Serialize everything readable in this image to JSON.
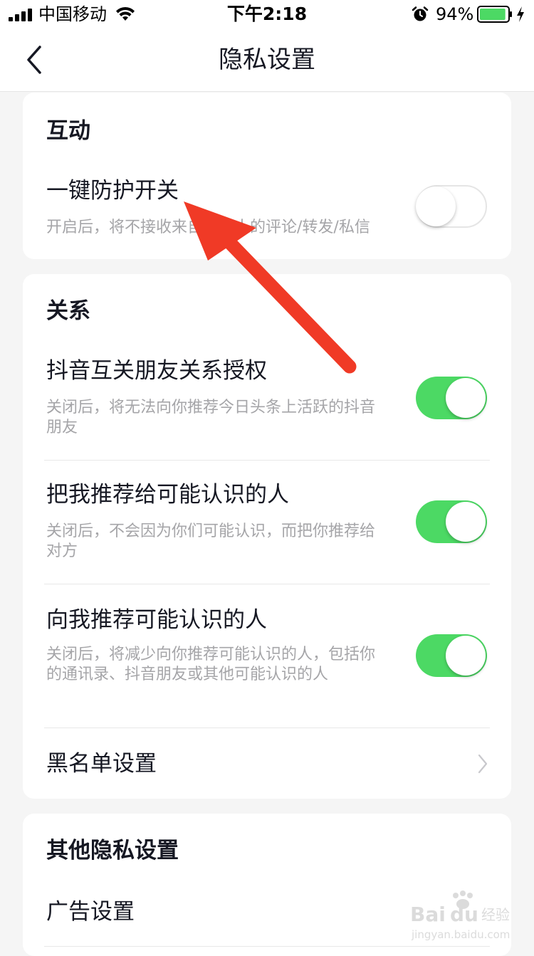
{
  "status_bar": {
    "carrier": "中国移动",
    "time": "下午2:18",
    "battery_percent": "94%",
    "battery_level": 0.94,
    "battery_color": "#4cd964"
  },
  "nav": {
    "title": "隐私设置",
    "back_icon": "chevron-left-icon"
  },
  "sections": [
    {
      "title": "互动",
      "rows": [
        {
          "title": "一键防护开关",
          "desc": "开启后，将不接收来自陌生人的评论/转发/私信",
          "toggle": false
        }
      ]
    },
    {
      "title": "关系",
      "rows": [
        {
          "title": "抖音互关朋友关系授权",
          "desc": "关闭后，将无法向你推荐今日头条上活跃的抖音朋友",
          "toggle": true
        },
        {
          "title": "把我推荐给可能认识的人",
          "desc": "关闭后，不会因为你们可能认识，而把你推荐给对方",
          "toggle": true
        },
        {
          "title": "向我推荐可能认识的人",
          "desc": "关闭后，将减少向你推荐可能认识的人，包括你的通讯录、抖音朋友或其他可能认识的人",
          "toggle": true
        },
        {
          "title": "黑名单设置",
          "chevron": "chevron-right-icon"
        }
      ]
    },
    {
      "title": "其他隐私设置",
      "rows": [
        {
          "title": "广告设置"
        }
      ]
    }
  ],
  "colors": {
    "toggle_on": "#4cd964",
    "annotation_arrow": "#f03a26",
    "text_primary": "#161823",
    "text_secondary": "#a5a5a8"
  },
  "watermark": {
    "brand": "Baidu经验",
    "url": "jingyan.baidu.com"
  }
}
